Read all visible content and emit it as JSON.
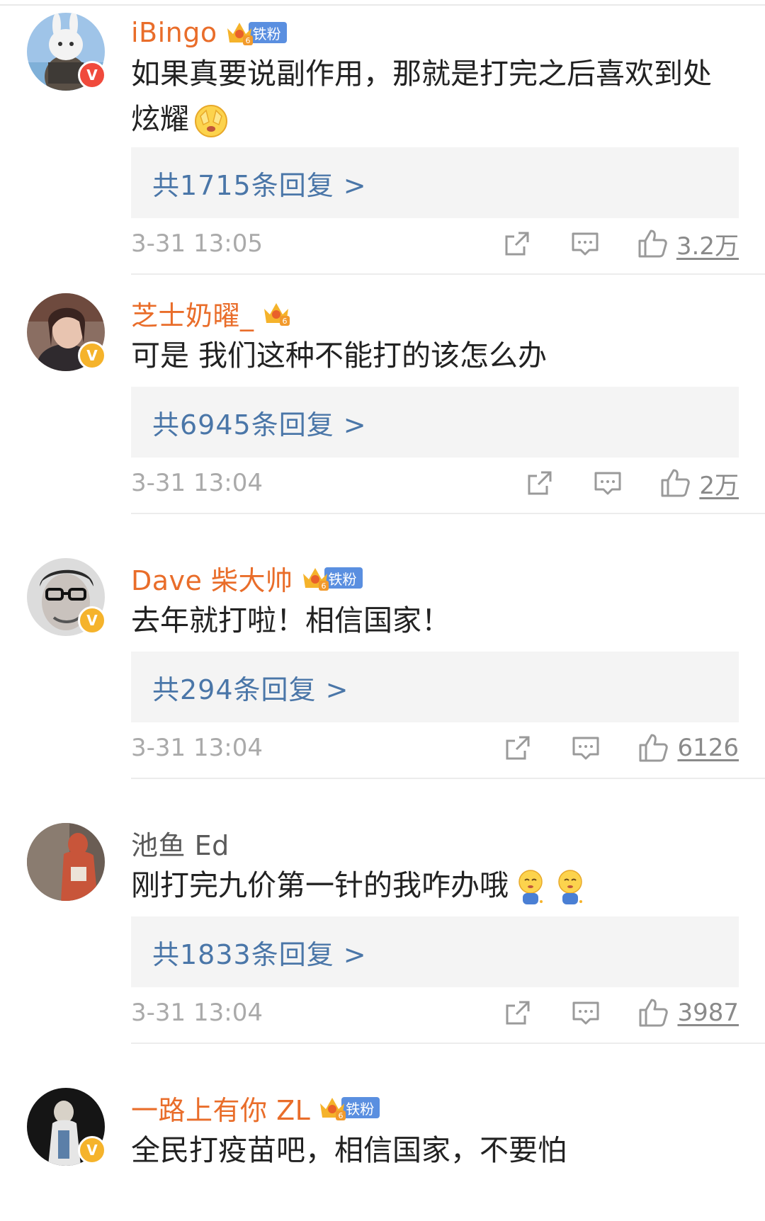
{
  "comments": [
    {
      "username": "iBingo",
      "fan_badge": "铁粉",
      "crown_level": "6",
      "verified": "V",
      "text": "如果真要说副作用，那就是打完之后喜欢到处炫耀",
      "emoji_icons": [
        "facepalm-emoji"
      ],
      "reply_label": "共1715条回复 >",
      "timestamp": "3-31 13:05",
      "likes": "3.2万"
    },
    {
      "username": "芝士奶曜_",
      "fan_badge": "",
      "crown_level": "6",
      "verified": "V",
      "text": "可是 我们这种不能打的该怎么办",
      "reply_label": "共6945条回复 >",
      "timestamp": "3-31 13:04",
      "likes": "2万"
    },
    {
      "username": "Dave 柴大帅",
      "fan_badge": "铁粉",
      "crown_level": "6",
      "verified": "V",
      "text": "去年就打啦！相信国家！",
      "reply_label": "共294条回复 >",
      "timestamp": "3-31 13:04",
      "likes": "6126"
    },
    {
      "username": "池鱼 Ed",
      "fan_badge": "",
      "crown_level": "",
      "verified": "",
      "text": "刚打完九价第一针的我咋办哦",
      "emoji_icons": [
        "shy-emoji",
        "shy-emoji"
      ],
      "reply_label": "共1833条回复 >",
      "timestamp": "3-31 13:04",
      "likes": "3987"
    },
    {
      "username": "一路上有你 ZL",
      "fan_badge": "铁粉",
      "crown_level": "6",
      "verified": "V",
      "text": "全民打疫苗吧，相信国家，不要怕"
    }
  ],
  "colors": {
    "username": "#e96d2a",
    "reply_link": "#4a76a8",
    "timestamp": "#aaaaaa",
    "verified_red": "#f04a3c",
    "verified_gold": "#f5b32b",
    "fan_badge_bg": "#5a8fe0"
  },
  "icons": [
    "share-icon",
    "comment-icon",
    "thumbs-up-icon",
    "crown-icon",
    "verified-icon"
  ]
}
